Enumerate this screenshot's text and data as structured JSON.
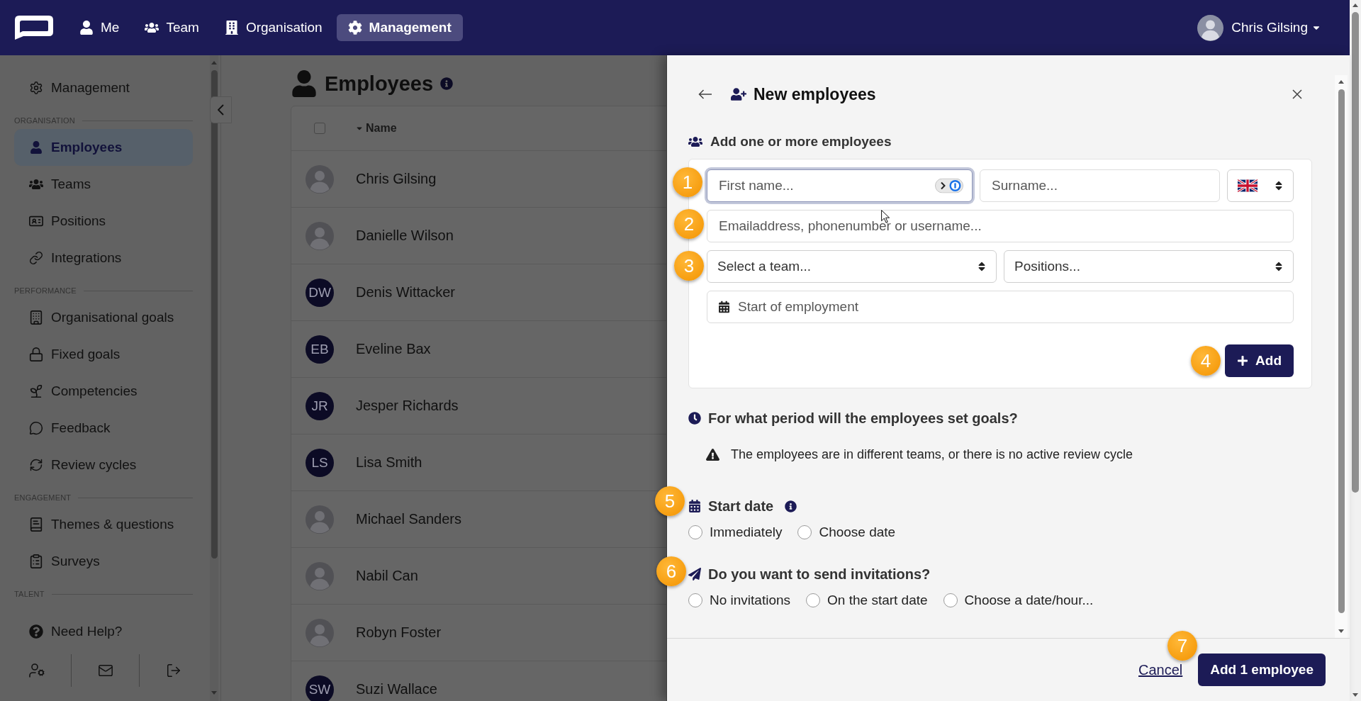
{
  "top_nav": {
    "items": [
      {
        "label": "Me",
        "selected": false
      },
      {
        "label": "Team",
        "selected": false
      },
      {
        "label": "Organisation",
        "selected": false
      },
      {
        "label": "Management",
        "selected": true
      }
    ],
    "user_name": "Chris Gilsing"
  },
  "sidebar": {
    "title": "Management",
    "sections": [
      {
        "title": "ORGANISATION",
        "items": [
          {
            "label": "Employees",
            "selected": true
          },
          {
            "label": "Teams",
            "selected": false
          },
          {
            "label": "Positions",
            "selected": false
          },
          {
            "label": "Integrations",
            "selected": false
          }
        ]
      },
      {
        "title": "PERFORMANCE",
        "items": [
          {
            "label": "Organisational goals",
            "selected": false
          },
          {
            "label": "Fixed goals",
            "selected": false
          },
          {
            "label": "Competencies",
            "selected": false
          },
          {
            "label": "Feedback",
            "selected": false
          },
          {
            "label": "Review cycles",
            "selected": false
          }
        ]
      },
      {
        "title": "ENGAGEMENT",
        "items": [
          {
            "label": "Themes & questions",
            "selected": false
          },
          {
            "label": "Surveys",
            "selected": false
          }
        ]
      },
      {
        "title": "TALENT"
      }
    ],
    "help_link": "Need Help?"
  },
  "page": {
    "title": "Employees"
  },
  "table": {
    "select_all_checked": false,
    "columns": [
      {
        "label": "Name",
        "sorted": true
      }
    ],
    "rows": [
      {
        "kind": "photo",
        "name": "Chris Gilsing"
      },
      {
        "kind": "photo",
        "name": "Danielle Wilson"
      },
      {
        "kind": "initials",
        "initials": "DW",
        "name": "Denis Wittacker"
      },
      {
        "kind": "initials",
        "initials": "EB",
        "name": "Eveline Bax"
      },
      {
        "kind": "initials",
        "initials": "JR",
        "name": "Jesper Richards"
      },
      {
        "kind": "initials",
        "initials": "LS",
        "name": "Lisa Smith"
      },
      {
        "kind": "photo",
        "name": "Michael Sanders"
      },
      {
        "kind": "photo",
        "name": "Nabil Can"
      },
      {
        "kind": "photo",
        "name": "Robyn Foster"
      },
      {
        "kind": "initials",
        "initials": "SW",
        "name": "Suzi Wallace"
      }
    ]
  },
  "drawer": {
    "title": "New employees",
    "section_title": "Add one or more employees",
    "first_name": {
      "placeholder": "First name...",
      "focused": true
    },
    "surname": {
      "placeholder": "Surname..."
    },
    "contact": {
      "placeholder": "Emailaddress, phonenumber or username..."
    },
    "team": {
      "placeholder": "Select a team..."
    },
    "positions": {
      "placeholder": "Positions..."
    },
    "start_of_employment": {
      "placeholder": "Start of employment"
    },
    "add_button": "Add",
    "goal_period": {
      "title": "For what period will the employees set goals?",
      "warning": "The employees are in different teams, or there is no active review cycle"
    },
    "start_date": {
      "title": "Start date",
      "options": [
        {
          "label": "Immediately",
          "selected": false
        },
        {
          "label": "Choose date",
          "selected": false
        }
      ]
    },
    "invitations": {
      "title": "Do you want to send invitations?",
      "options": [
        {
          "label": "No invitations",
          "selected": false
        },
        {
          "label": "On the start date",
          "selected": false
        },
        {
          "label": "Choose a date/hour...",
          "selected": false
        }
      ]
    },
    "cancel_link": "Cancel",
    "submit_button": "Add 1 employee"
  },
  "step_markers": [
    "1",
    "2",
    "3",
    "4",
    "5",
    "6",
    "7"
  ]
}
